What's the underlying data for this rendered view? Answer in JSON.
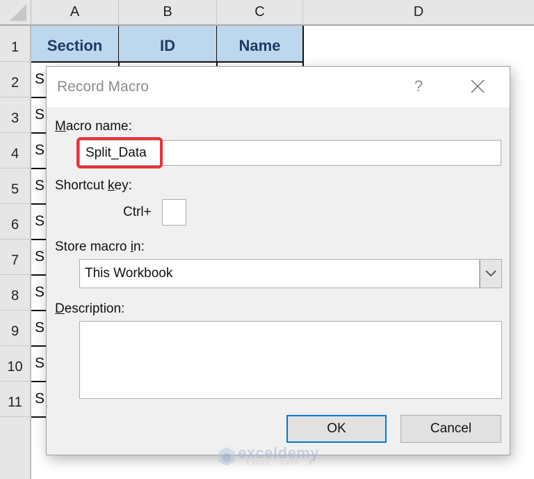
{
  "spreadsheet": {
    "columns": [
      "A",
      "B",
      "C",
      "D"
    ],
    "rows": [
      "1",
      "2",
      "3",
      "4",
      "5",
      "6",
      "7",
      "8",
      "9",
      "10",
      "11"
    ],
    "header_cells": [
      "Section",
      "ID",
      "Name"
    ],
    "visible_cell_text": [
      "S",
      "S",
      "S",
      "S",
      "S",
      "S",
      "S",
      "S",
      "S",
      "S"
    ],
    "header_fill_color": "#bdd7ee"
  },
  "dialog": {
    "title": "Record Macro",
    "help_label": "?",
    "close_icon": "close-icon",
    "macro_name": {
      "label_accel": "M",
      "label_rest": "acro name:",
      "value": "Split_Data",
      "highlight_color": "#e8333a"
    },
    "shortcut": {
      "label_pre": "Shortcut ",
      "label_accel": "k",
      "label_post": "ey:",
      "prefix": "Ctrl+",
      "value": ""
    },
    "store": {
      "label_pre": "Store macro ",
      "label_accel": "i",
      "label_post": "n:",
      "selected": "This Workbook",
      "dropdown_icon": "chevron-down-icon"
    },
    "description": {
      "label_accel": "D",
      "label_rest": "escription:",
      "value": ""
    },
    "ok_label": "OK",
    "cancel_label": "Cancel",
    "accent_color": "#0078d7"
  },
  "watermark": {
    "brand": "exceldemy",
    "tagline": "EXCEL · DATA · BI"
  }
}
